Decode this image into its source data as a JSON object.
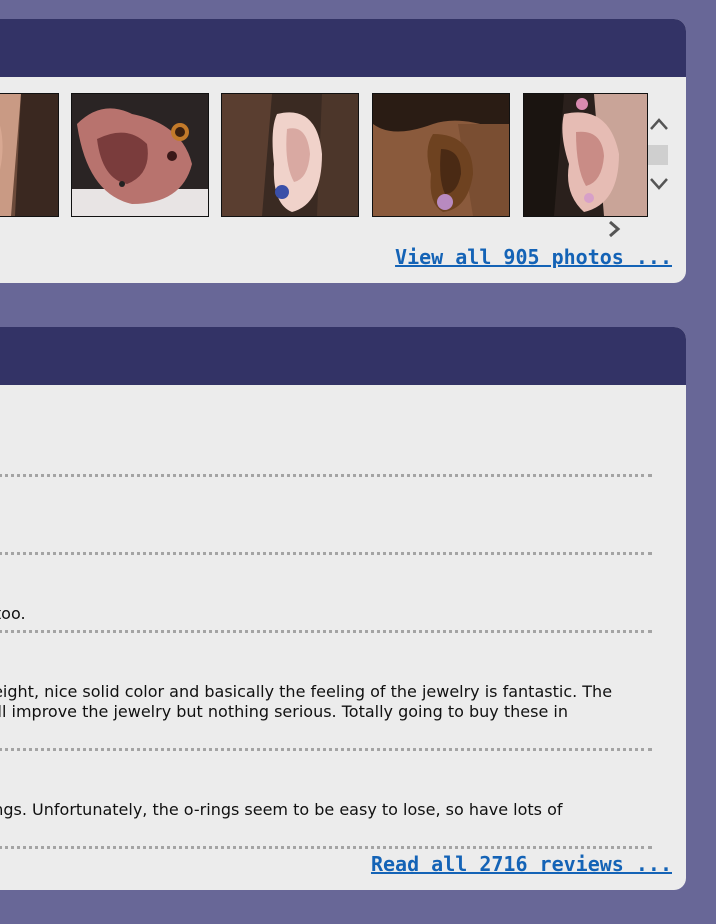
{
  "photos": {
    "view_all_label": "View all 905 photos ...",
    "thumbnails": [
      {
        "name": "ear-photo-1"
      },
      {
        "name": "ear-photo-2"
      },
      {
        "name": "ear-photo-3"
      },
      {
        "name": "ear-photo-4"
      },
      {
        "name": "ear-photo-5"
      }
    ],
    "icons": {
      "scroll_up": "chevron-up-icon",
      "scroll_down": "chevron-down-icon",
      "next": "chevron-right-icon"
    }
  },
  "reviews": {
    "read_all_label": "Read all 2716 reviews ...",
    "items": [
      {
        "lines": []
      },
      {
        "lines": []
      },
      {
        "lines": [
          "a too."
        ]
      },
      {
        "lines": [
          " weight, nice solid color and basically the feeling of the jewelry is fantastic. The",
          "will improve the jewelry but nothing serious. Totally going to buy these in"
        ]
      },
      {
        "lines": [
          "cings. Unfortunately, the o-rings seem to be easy to lose, so have lots of"
        ]
      }
    ]
  },
  "colors": {
    "page_background": "#686797",
    "panel_header": "#333366",
    "panel_body": "#ececec",
    "link": "#1463b6"
  }
}
